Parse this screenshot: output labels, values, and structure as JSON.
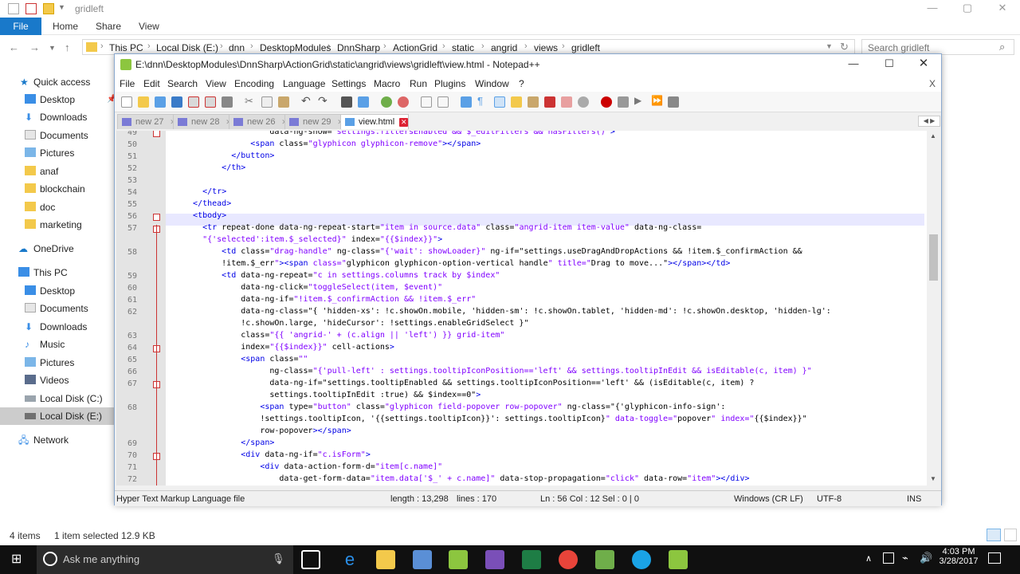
{
  "explorer": {
    "title": "gridleft",
    "ribbon": {
      "file": "File",
      "tabs": [
        "Home",
        "Share",
        "View"
      ]
    },
    "breadcrumb": [
      "This PC",
      "Local Disk (E:)",
      "dnn",
      "DesktopModules",
      "DnnSharp",
      "ActionGrid",
      "static",
      "angrid",
      "views",
      "gridleft"
    ],
    "search_placeholder": "Search gridleft",
    "nav": {
      "quick_access": "Quick access",
      "quick": [
        "Desktop",
        "Downloads",
        "Documents",
        "Pictures",
        "anaf",
        "blockchain",
        "doc",
        "marketing"
      ],
      "onedrive": "OneDrive",
      "this_pc": "This PC",
      "pc": [
        "Desktop",
        "Documents",
        "Downloads",
        "Music",
        "Pictures",
        "Videos",
        "Local Disk (C:)",
        "Local Disk (E:)"
      ],
      "network": "Network"
    },
    "status": {
      "items": "4 items",
      "selected": "1 item selected  12.9 KB"
    }
  },
  "notepad": {
    "title": "E:\\dnn\\DesktopModules\\DnnSharp\\ActionGrid\\static\\angrid\\views\\gridleft\\view.html - Notepad++",
    "menu": [
      "File",
      "Edit",
      "Search",
      "View",
      "Encoding",
      "Language",
      "Settings",
      "Macro",
      "Run",
      "Plugins",
      "Window",
      "?"
    ],
    "close_x": "X",
    "tabs": [
      "new 27",
      "new 28",
      "new 26",
      "new 29",
      "view.html"
    ],
    "lines": [
      {
        "n": "49",
        "t": "                  data-ng-show=\"settings.filtersEnabled && $_editFilters && hasFilters()\">"
      },
      {
        "n": "50",
        "t": "              <span class=\"glyphicon glyphicon-remove\"></span>"
      },
      {
        "n": "51",
        "t": "          </button>"
      },
      {
        "n": "52",
        "t": "        </th>"
      },
      {
        "n": "53",
        "t": ""
      },
      {
        "n": "54",
        "t": "    </tr>"
      },
      {
        "n": "55",
        "t": "  </thead>"
      },
      {
        "n": "56",
        "t": "  <tbody>"
      },
      {
        "n": "57",
        "t": "    <tr repeat-done data-ng-repeat-start=\"item in source.data\" class=\"angrid-item item-value\" data-ng-class="
      },
      {
        "n": "",
        "t": "    \"{'selected':item.$_selected}\" index=\"{{$index}}\">"
      },
      {
        "n": "58",
        "t": "        <td class=\"drag-handle\" ng-class=\"{'wait': showLoader}\" ng-if=\"settings.useDragAndDropActions && !item.$_confirmAction &&"
      },
      {
        "n": "",
        "t": "        !item.$_err\"><span class=\"glyphicon glyphicon-option-vertical handle\" title=\"Drag to move...\"></span></td>"
      },
      {
        "n": "59",
        "t": "        <td data-ng-repeat=\"c in settings.columns track by $index\""
      },
      {
        "n": "60",
        "t": "            data-ng-click=\"toggleSelect(item, $event)\""
      },
      {
        "n": "61",
        "t": "            data-ng-if=\"!item.$_confirmAction && !item.$_err\""
      },
      {
        "n": "62",
        "t": "            data-ng-class=\"{ 'hidden-xs': !c.showOn.mobile, 'hidden-sm': !c.showOn.tablet, 'hidden-md': !c.showOn.desktop, 'hidden-lg':"
      },
      {
        "n": "",
        "t": "            !c.showOn.large, 'hideCursor': !settings.enableGridSelect }\""
      },
      {
        "n": "63",
        "t": "            class=\"{{ 'angrid-' + (c.align || 'left') }} grid-item\""
      },
      {
        "n": "64",
        "t": "            index=\"{{$index}}\" cell-actions>"
      },
      {
        "n": "65",
        "t": "            <span class=\"\""
      },
      {
        "n": "66",
        "t": "                  ng-class=\"{'pull-left' : settings.tooltipIconPosition=='left' && settings.tooltipInEdit && isEditable(c, item) }\""
      },
      {
        "n": "67",
        "t": "                  data-ng-if=\"settings.tooltipEnabled && settings.tooltipIconPosition=='left' && (isEditable(c, item) ?"
      },
      {
        "n": "",
        "t": "                  settings.tooltipInEdit :true) && $index==0\">"
      },
      {
        "n": "68",
        "t": "                <span type=\"button\" class=\"glyphicon field-popover row-popover\" ng-class=\"{'glyphicon-info-sign':"
      },
      {
        "n": "",
        "t": "                !settings.tooltipIcon, '{{settings.tooltipIcon}}': settings.tooltipIcon}\" data-toggle=\"popover\" index=\"{{$index}}\""
      },
      {
        "n": "",
        "t": "                row-popover></span>"
      },
      {
        "n": "69",
        "t": "            </span>"
      },
      {
        "n": "70",
        "t": "            <div data-ng-if=\"c.isForm\">"
      },
      {
        "n": "71",
        "t": "                <div data-action-form-d=\"item[c.name]\""
      },
      {
        "n": "72",
        "t": "                    data-get-form-data=\"item.data['$_' + c.name]\" data-stop-propagation=\"click\" data-row=\"item\"></div>"
      }
    ],
    "status": {
      "type": "Hyper Text Markup Language file",
      "length": "length : 13,298",
      "lines": "lines : 170",
      "pos": "Ln : 56    Col : 12    Sel : 0 | 0",
      "eol": "Windows (CR LF)",
      "enc": "UTF-8",
      "mode": "INS"
    }
  },
  "taskbar": {
    "search": "Ask me anything",
    "time": "4:03 PM",
    "date": "3/28/2017"
  },
  "colors": {
    "accent": "#1979ca",
    "taskbar": "#101010",
    "tag": "#0000e6",
    "attr": "#c80000",
    "value": "#8000ff"
  }
}
